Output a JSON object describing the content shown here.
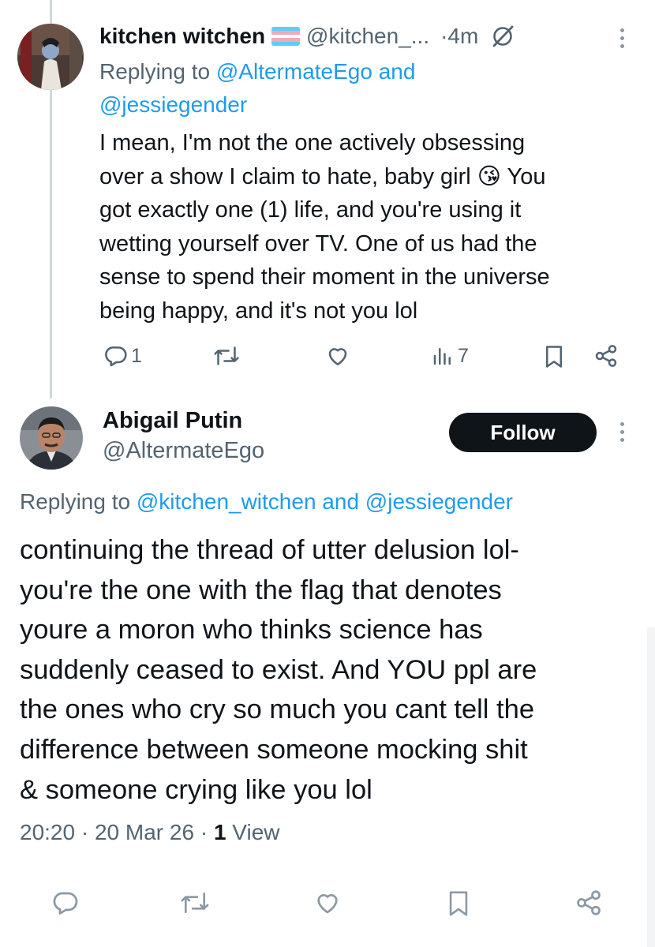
{
  "reply_tweet": {
    "display_name": "kitchen witchen",
    "handle": "@kitchen_...",
    "time": "·4m",
    "replying_prefix": "Replying to ",
    "replying_to": "@AltermateEgo and",
    "replying_to_2": "@jessiegender",
    "text_lines": [
      "I mean, I'm not the one actively obsessing",
      "over a show I claim to hate, baby girl",
      "You",
      "got exactly one (1) life, and you're using it",
      "wetting yourself over TV. One of us had the",
      "sense to spend their moment in the universe",
      "being happy, and it's not you lol"
    ],
    "emoji": "😘",
    "reply_count": "1",
    "view_count": "7"
  },
  "main_tweet": {
    "display_name": "Abigail Putin",
    "handle": "@AltermateEgo",
    "follow_label": "Follow",
    "replying_prefix": "Replying to ",
    "replying_to": "@kitchen_witchen and @jessiegender",
    "text_lines": [
      "continuing the thread of utter delusion lol-",
      "you're the one with the flag that denotes",
      "youre a moron who thinks science has",
      "suddenly ceased to exist. And YOU ppl are",
      "the ones who cry so much you cant tell the",
      "difference between someone mocking shit",
      "& someone crying like you lol"
    ],
    "time": "20:20",
    "date": "20 Mar 26",
    "view_count": "1",
    "view_label": "View"
  },
  "icons": [
    "reply-icon",
    "retweet-icon",
    "like-icon",
    "views-icon",
    "bookmark-icon",
    "share-icon",
    "grok-icon",
    "more-icon",
    "trans-flag-icon"
  ],
  "colors": {
    "link": "#1d9bf0",
    "muted": "#536471",
    "text": "#0f1419",
    "thread_line": "#cfd9de"
  }
}
